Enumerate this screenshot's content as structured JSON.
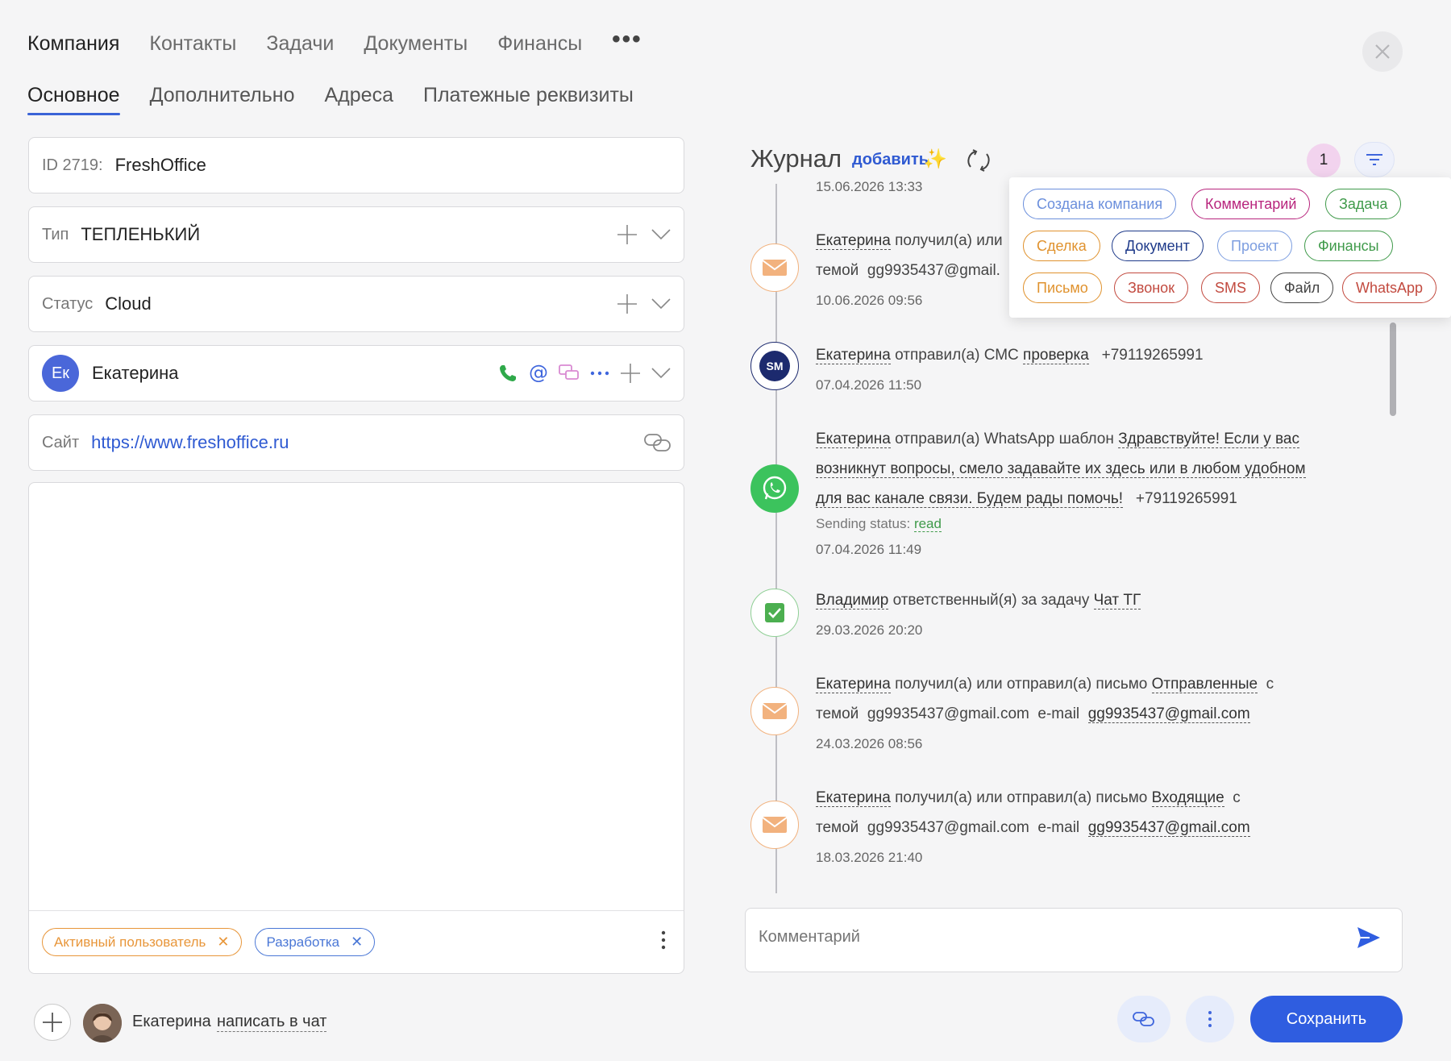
{
  "top_tabs": [
    {
      "label": "Компания",
      "active": true
    },
    {
      "label": "Контакты"
    },
    {
      "label": "Задачи"
    },
    {
      "label": "Документы"
    },
    {
      "label": "Финансы"
    }
  ],
  "more_symbol": "•••",
  "sub_tabs": [
    {
      "label": "Основное",
      "active": true
    },
    {
      "label": "Дополнительно"
    },
    {
      "label": "Адреса"
    },
    {
      "label": "Платежные реквизиты"
    }
  ],
  "form": {
    "id_label": "ID 2719:",
    "name_value": "FreshOffice",
    "type_label": "Тип",
    "type_value": "ТЕПЛЕНЬКИЙ",
    "status_label": "Статус",
    "status_value": "Cloud",
    "contact_initials": "Ек",
    "contact_name": "Екатерина",
    "site_label": "Сайт",
    "site_value": "https://www.freshoffice.ru"
  },
  "tags": [
    {
      "label": "Активный пользователь",
      "color": "#e8963a"
    },
    {
      "label": "Разработка",
      "color": "#4a77d6"
    }
  ],
  "bottom": {
    "user_name": "Екатерина",
    "chat_link": "написать в чат",
    "save_label": "Сохранить"
  },
  "journal": {
    "title": "Журнал",
    "add_label": "добавить",
    "spark": "✨",
    "count": "1",
    "truncated_date": "15.06.2026  13:33",
    "entries": [
      {
        "type": "email",
        "user": "Екатерина",
        "text1": "получил(а) или",
        "text2": "темой",
        "email": "gg9935437@gmail.",
        "date": "10.06.2026  09:56"
      },
      {
        "type": "sms",
        "user": "Екатерина",
        "action": "отправил(а) СМС",
        "link": "проверка",
        "phone": "+79119265991",
        "date": "07.04.2026  11:50",
        "badge": "SM"
      },
      {
        "type": "whatsapp",
        "user": "Екатерина",
        "action": "отправил(а) WhatsApp шаблон",
        "line1": "Здравствуйте! Если у вас",
        "line2": "возникнут вопросы, смело задавайте их здесь или в любом удобном",
        "line3": "для вас канале связи. Будем рады помочь!",
        "phone": "+79119265991",
        "status_label": "Sending status:",
        "status_value": "read",
        "date": "07.04.2026  11:49"
      },
      {
        "type": "task",
        "user": "Владимир",
        "action": "ответственный(я) за задачу",
        "link": "Чат ТГ",
        "date": "29.03.2026  20:20"
      },
      {
        "type": "email",
        "user": "Екатерина",
        "action": "получил(а) или отправил(а) письмо",
        "folder": "Отправленные",
        "c": "с",
        "theme": "темой",
        "email": "gg9935437@gmail.com",
        "email_label": "e-mail",
        "email_link": "gg9935437@gmail.com",
        "date": "24.03.2026  08:56"
      },
      {
        "type": "email",
        "user": "Екатерина",
        "action": "получил(а) или отправил(а) письмо",
        "folder": "Входящие",
        "c": "с",
        "theme": "темой",
        "email": "gg9935437@gmail.com",
        "email_label": "e-mail",
        "email_link": "gg9935437@gmail.com",
        "date": "18.03.2026  21:40"
      }
    ]
  },
  "filters": [
    {
      "label": "Создана компания",
      "color": "#6b8fdc"
    },
    {
      "label": "Комментарий",
      "color": "#b8257d"
    },
    {
      "label": "Задача",
      "color": "#3f9a4a"
    },
    {
      "label": "Сделка",
      "color": "#e0922e"
    },
    {
      "label": "Документ",
      "color": "#1e3a8a"
    },
    {
      "label": "Проект",
      "color": "#7d9ee0"
    },
    {
      "label": "Финансы",
      "color": "#3f9a4a"
    },
    {
      "label": "Письмо",
      "color": "#e0922e"
    },
    {
      "label": "Звонок",
      "color": "#c24a3f"
    },
    {
      "label": "SMS",
      "color": "#c24a3f"
    },
    {
      "label": "Файл",
      "color": "#444444"
    },
    {
      "label": "WhatsApp",
      "color": "#c24a3f"
    }
  ],
  "comment": {
    "placeholder": "Комментарий"
  },
  "colors": {
    "accent": "#2f5de0",
    "email_icon": "#f2b27e",
    "whatsapp": "#3cc35d",
    "task": "#4caf50",
    "sms_badge": "#1c2a6e"
  }
}
